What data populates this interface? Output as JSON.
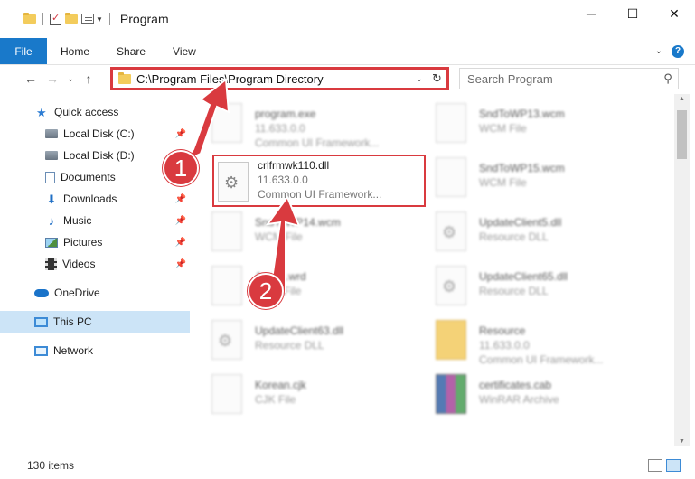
{
  "window": {
    "title": "Program"
  },
  "ribbon": {
    "file": "File",
    "tabs": [
      "Home",
      "Share",
      "View"
    ]
  },
  "address": {
    "path": "C:\\Program Files\\Program Directory"
  },
  "search": {
    "placeholder": "Search Program"
  },
  "sidebar": {
    "items": [
      {
        "label": "Quick access",
        "icon": "star-icon"
      },
      {
        "label": "Local Disk (C:)",
        "icon": "disk-icon",
        "pinned": true
      },
      {
        "label": "Local Disk (D:)",
        "icon": "disk-icon"
      },
      {
        "label": "Documents",
        "icon": "documents-icon"
      },
      {
        "label": "Downloads",
        "icon": "downloads-icon",
        "pinned": true
      },
      {
        "label": "Music",
        "icon": "music-icon",
        "pinned": true
      },
      {
        "label": "Pictures",
        "icon": "pictures-icon",
        "pinned": true
      },
      {
        "label": "Videos",
        "icon": "videos-icon",
        "pinned": true
      },
      {
        "label": "OneDrive",
        "icon": "onedrive-icon"
      },
      {
        "label": "This PC",
        "icon": "this-pc-icon",
        "selected": true
      },
      {
        "label": "Network",
        "icon": "network-icon"
      }
    ]
  },
  "files": {
    "col1": [
      {
        "name": "program.exe",
        "line2": "11.633.0.0",
        "line3": "Common UI Framework..."
      },
      {
        "name": "crlfrmwk110.dll",
        "line2": "11.633.0.0",
        "line3": "Common UI Framework..."
      },
      {
        "name": "SndToWP14.wcm",
        "line2": "WCM File",
        "line3": ""
      },
      {
        "name": "Arabic.wrd",
        "line2": "WRD File",
        "line3": ""
      },
      {
        "name": "UpdateClient63.dll",
        "line2": "Resource DLL",
        "line3": ""
      },
      {
        "name": "Korean.cjk",
        "line2": "CJK File",
        "line3": ""
      }
    ],
    "col2": [
      {
        "name": "SndToWP13.wcm",
        "line2": "WCM File",
        "line3": ""
      },
      {
        "name": "SndToWP15.wcm",
        "line2": "WCM File",
        "line3": ""
      },
      {
        "name": "UpdateClient5.dll",
        "line2": "Resource DLL",
        "line3": ""
      },
      {
        "name": "UpdateClient65.dll",
        "line2": "Resource DLL",
        "line3": ""
      },
      {
        "name": "Resource",
        "line2": "11.633.0.0",
        "line3": "Common UI Framework..."
      },
      {
        "name": "certificates.cab",
        "line2": "WinRAR Archive",
        "line3": ""
      }
    ]
  },
  "status": {
    "items": "130 items"
  },
  "annotations": {
    "step1": "1",
    "step2": "2"
  },
  "colors": {
    "accent": "#1979ca",
    "highlight": "#d93a3f",
    "selection": "#cce4f7"
  }
}
